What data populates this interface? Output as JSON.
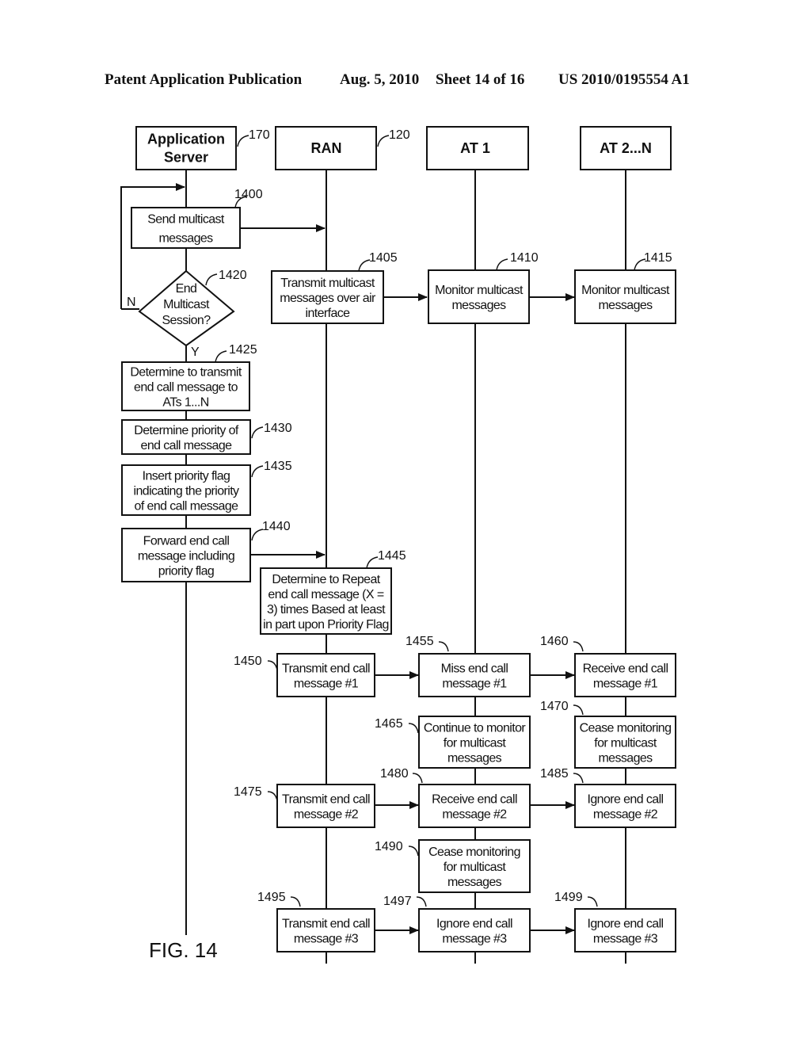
{
  "header": {
    "publication": "Patent Application Publication",
    "date": "Aug. 5, 2010",
    "sheet": "Sheet 14 of 16",
    "number": "US 2010/0195554 A1"
  },
  "figure_label": "FIG. 14",
  "lanes": [
    {
      "id": "app-server",
      "ref": "170",
      "title": [
        "Application",
        "Server"
      ]
    },
    {
      "id": "ran",
      "ref": "120",
      "title": [
        "RAN"
      ]
    },
    {
      "id": "at1",
      "ref": "",
      "title": [
        "AT 1"
      ]
    },
    {
      "id": "at2n",
      "ref": "",
      "title": [
        "AT 2...N"
      ]
    }
  ],
  "steps": {
    "s1400": {
      "ref": "1400",
      "lines": [
        "Send multicast",
        "messages"
      ]
    },
    "s1405": {
      "ref": "1405",
      "lines": [
        "Transmit multicast",
        "messages over air",
        "interface"
      ]
    },
    "s1410": {
      "ref": "1410",
      "lines": [
        "Monitor multicast",
        "messages"
      ]
    },
    "s1415": {
      "ref": "1415",
      "lines": [
        "Monitor multicast",
        "messages"
      ]
    },
    "s1420": {
      "ref": "1420",
      "lines": [
        "End",
        "Multicast",
        "Session?"
      ],
      "yes": "Y",
      "no": "N"
    },
    "s1425": {
      "ref": "1425",
      "lines": [
        "Determine to transmit",
        "end call message to",
        "ATs 1...N"
      ]
    },
    "s1430": {
      "ref": "1430",
      "lines": [
        "Determine priority of",
        "end call message"
      ]
    },
    "s1435": {
      "ref": "1435",
      "lines": [
        "Insert priority flag",
        "indicating the priority",
        "of end call message"
      ]
    },
    "s1440": {
      "ref": "1440",
      "lines": [
        "Forward end call",
        "message including",
        "priority flag"
      ]
    },
    "s1445": {
      "ref": "1445",
      "lines": [
        "Determine to Repeat",
        "end call message (X =",
        "3) times Based at least",
        "in part upon Priority Flag"
      ]
    },
    "s1450": {
      "ref": "1450",
      "lines": [
        "Transmit end call",
        "message #1"
      ]
    },
    "s1455": {
      "ref": "1455",
      "lines": [
        "Miss end call",
        "message #1"
      ]
    },
    "s1460": {
      "ref": "1460",
      "lines": [
        "Receive end call",
        "message #1"
      ]
    },
    "s1465": {
      "ref": "1465",
      "lines": [
        "Continue to monitor",
        "for multicast",
        "messages"
      ]
    },
    "s1470": {
      "ref": "1470",
      "lines": [
        "Cease monitoring",
        "for multicast",
        "messages"
      ]
    },
    "s1475": {
      "ref": "1475",
      "lines": [
        "Transmit end call",
        "message #2"
      ]
    },
    "s1480": {
      "ref": "1480",
      "lines": [
        "Receive end call",
        "message #2"
      ]
    },
    "s1485": {
      "ref": "1485",
      "lines": [
        "Ignore end call",
        "message #2"
      ]
    },
    "s1490": {
      "ref": "1490",
      "lines": [
        "Cease monitoring",
        "for multicast",
        "messages"
      ]
    },
    "s1495": {
      "ref": "1495",
      "lines": [
        "Transmit end call",
        "message #3"
      ]
    },
    "s1497": {
      "ref": "1497",
      "lines": [
        "Ignore end call",
        "message #3"
      ]
    },
    "s1499": {
      "ref": "1499",
      "lines": [
        "Ignore end call",
        "message #3"
      ]
    }
  }
}
